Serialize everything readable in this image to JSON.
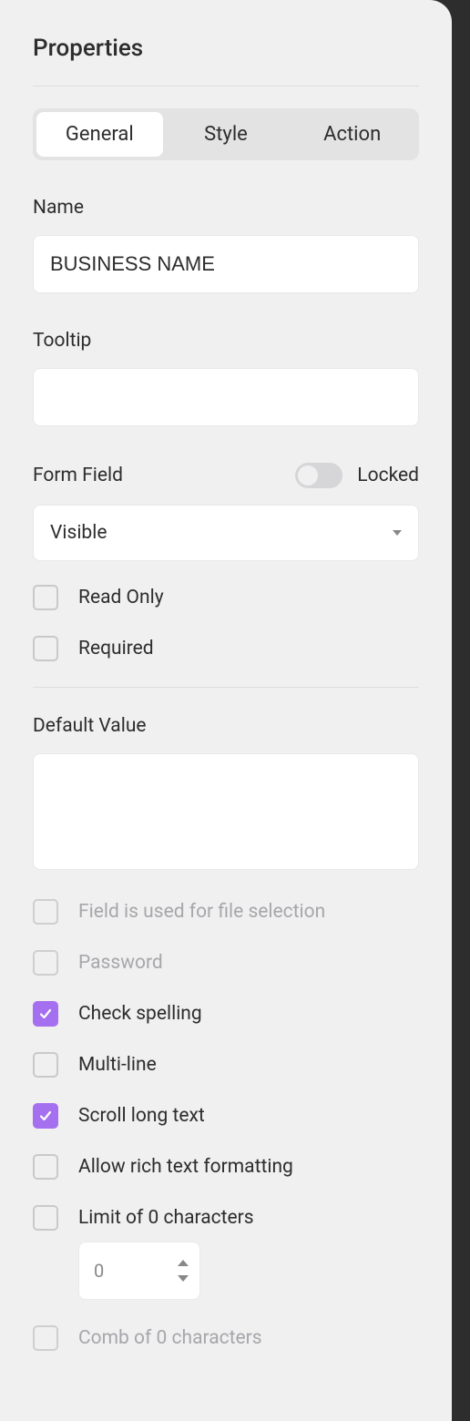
{
  "panel": {
    "title": "Properties"
  },
  "tabs": {
    "general": "General",
    "style": "Style",
    "action": "Action",
    "active": "general"
  },
  "fields": {
    "name_label": "Name",
    "name_value": "BUSINESS NAME",
    "tooltip_label": "Tooltip",
    "tooltip_value": "",
    "form_field_label": "Form Field",
    "locked_label": "Locked",
    "locked_value": false,
    "visibility_selected": "Visible",
    "read_only_label": "Read Only",
    "read_only_checked": false,
    "required_label": "Required",
    "required_checked": false,
    "default_value_label": "Default Value",
    "default_value": ""
  },
  "options": {
    "file_selection_label": "Field is used for file selection",
    "file_selection_checked": false,
    "file_selection_disabled": true,
    "password_label": "Password",
    "password_checked": false,
    "password_disabled": true,
    "check_spelling_label": "Check spelling",
    "check_spelling_checked": true,
    "multiline_label": "Multi-line",
    "multiline_checked": false,
    "scroll_long_text_label": "Scroll long text",
    "scroll_long_text_checked": true,
    "rich_text_label": "Allow rich text formatting",
    "rich_text_checked": false,
    "limit_label": "Limit of 0 characters",
    "limit_checked": false,
    "limit_value": "0",
    "comb_label": "Comb of 0 characters",
    "comb_checked": false,
    "comb_disabled": true
  },
  "colors": {
    "accent": "#a570ef",
    "panel_bg": "#f0f0f1"
  }
}
